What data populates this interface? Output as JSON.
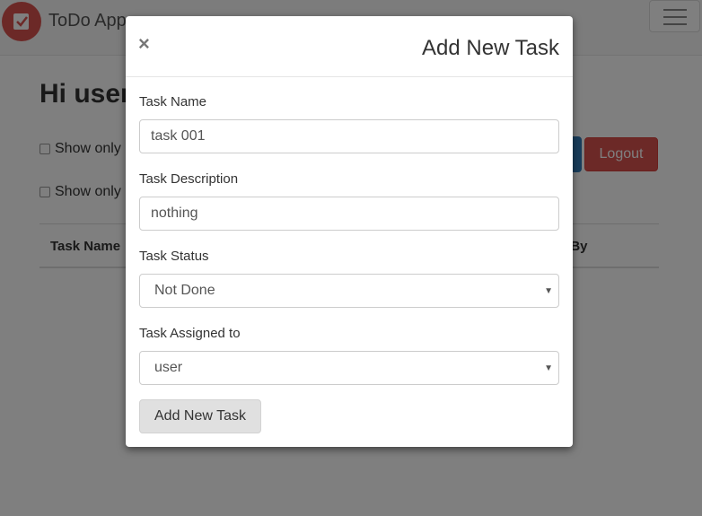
{
  "navbar": {
    "brand_name": "ToDo App",
    "logo_icon": "checklist-icon",
    "menu_icon": "hamburger-icon"
  },
  "page": {
    "greeting": "Hi user",
    "filter_1": "Show only",
    "filter_2": "Show only",
    "logout_label": "Logout",
    "table_headers": {
      "task_name": "Task Name",
      "assigned_by": "d By"
    }
  },
  "modal": {
    "close_label": "×",
    "title": "Add New Task",
    "task_name": {
      "label": "Task Name",
      "value": "task 001"
    },
    "task_description": {
      "label": "Task Description",
      "value": "nothing"
    },
    "task_status": {
      "label": "Task Status",
      "value": "Not Done"
    },
    "task_assigned": {
      "label": "Task Assigned to",
      "value": "user"
    },
    "submit_label": "Add New Task"
  },
  "colors": {
    "brand_red": "#d9534f",
    "primary_blue": "#337ab7",
    "backdrop": "rgba(0,0,0,0.5)"
  }
}
